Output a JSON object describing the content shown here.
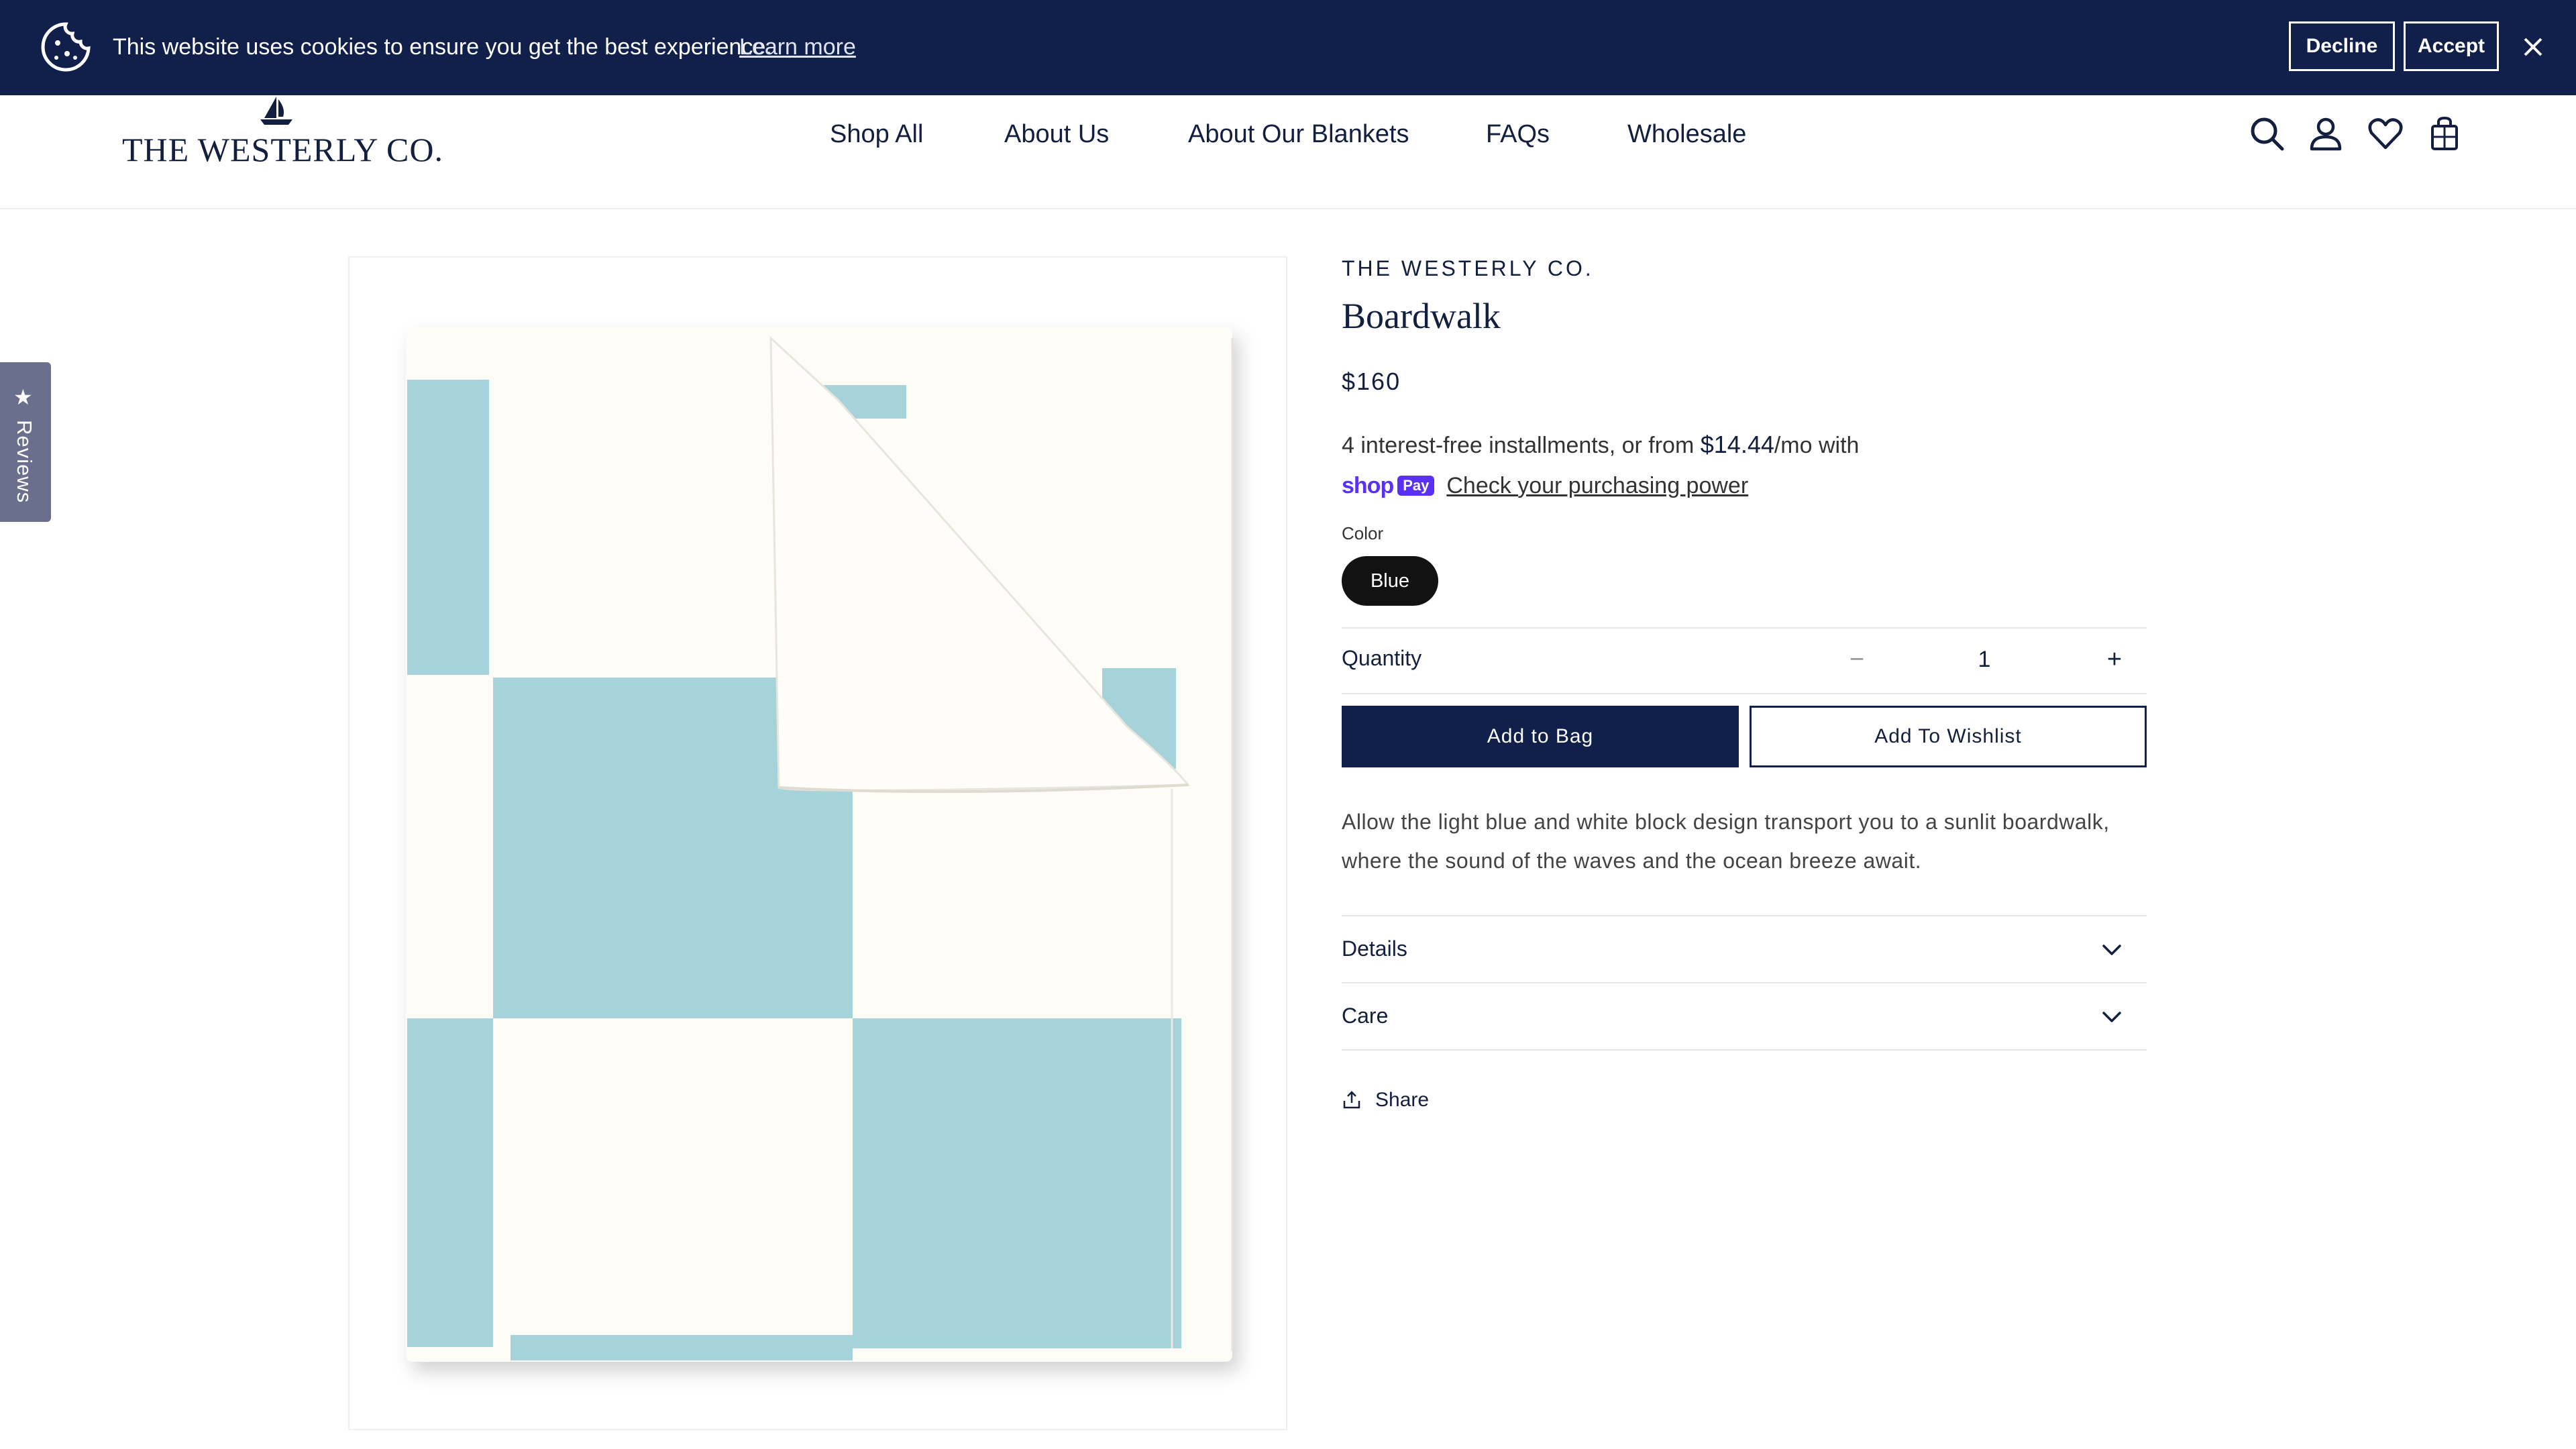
{
  "cookie_banner": {
    "message": "This website uses cookies to ensure you get the best experience.",
    "learn_more": "Learn more",
    "decline": "Decline",
    "accept": "Accept"
  },
  "header": {
    "logo_text": "THE WESTERLY CO.",
    "nav": [
      "Shop All",
      "About Us",
      "About Our Blankets",
      "FAQs",
      "Wholesale"
    ],
    "icons": [
      "search-icon",
      "account-icon",
      "wishlist-icon",
      "bag-icon"
    ]
  },
  "reviews_tab": {
    "label": "Reviews"
  },
  "product": {
    "vendor": "THE WESTERLY CO.",
    "title": "Boardwalk",
    "price": "$160",
    "installments_prefix": "4 interest-free installments, or from ",
    "installments_amount": "$14.44",
    "installments_suffix": "/mo with",
    "shop_pay_shop": "shop",
    "shop_pay_pay": "Pay",
    "check_power": "Check your purchasing power",
    "color_label": "Color",
    "color_selected": "Blue",
    "quantity_label": "Quantity",
    "quantity_minus": "−",
    "quantity_value": "1",
    "quantity_plus": "+",
    "add_to_bag": "Add to Bag",
    "add_to_wishlist": "Add To Wishlist",
    "description": "Allow the light blue and white block design transport you to a sunlit boardwalk, where the sound of the waves and the ocean breeze await.",
    "accordions": [
      "Details",
      "Care"
    ],
    "share": "Share"
  },
  "colors": {
    "navy": "#10204a",
    "blanket_blue": "#a6d2da",
    "blanket_white": "#fdfcf7"
  }
}
